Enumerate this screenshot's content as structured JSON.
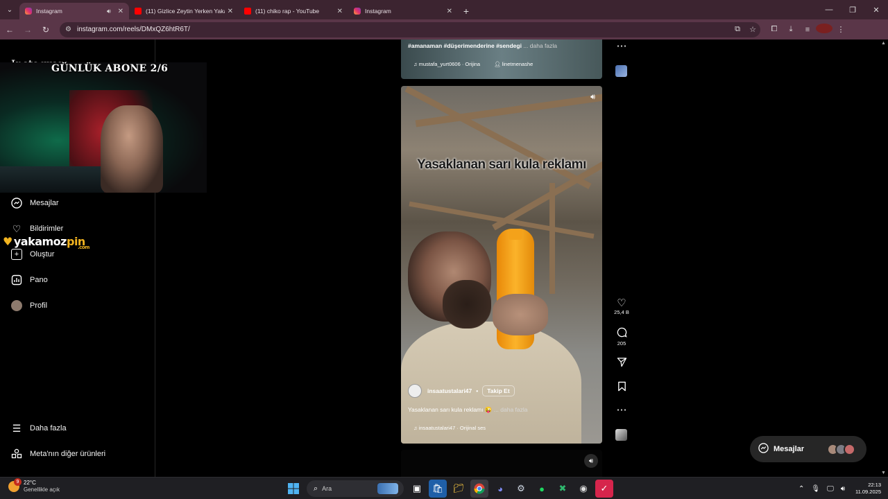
{
  "browser": {
    "tabs": [
      {
        "label": "Instagram",
        "icon": "instagram-icon",
        "active": true,
        "audio": true
      },
      {
        "label": "(11) Gizlice Zeytin Yerken Yakal...",
        "icon": "youtube-icon",
        "active": false
      },
      {
        "label": "(11) chiko rap - YouTube",
        "icon": "youtube-icon",
        "active": false
      },
      {
        "label": "Instagram",
        "icon": "instagram-icon",
        "active": false
      }
    ],
    "url": "instagram.com/reels/DMxQZ6htR6T/"
  },
  "sidebar": {
    "logo": "Instagram",
    "items": [
      {
        "label": "Mesajlar",
        "icon": "messenger-icon"
      },
      {
        "label": "Bildirimler",
        "icon": "heart-icon"
      },
      {
        "label": "Oluştur",
        "icon": "plus-square-icon"
      },
      {
        "label": "Pano",
        "icon": "dashboard-icon"
      },
      {
        "label": "Profil",
        "icon": "avatar-icon"
      }
    ],
    "bottom": [
      {
        "label": "Daha fazla",
        "icon": "hamburger-icon"
      },
      {
        "label": "Meta'nın diğer ürünleri",
        "icon": "grid-icon"
      }
    ]
  },
  "overlay": {
    "webcam_title": "GÜNLÜK ABONE 2/6",
    "watermark": {
      "main": "yakamoz",
      "accent": "pin",
      "suffix": ".com"
    }
  },
  "prev_reel": {
    "caption": "#amanaman #düşerimenderine #sendegi",
    "more": "... daha fazla",
    "audio": "mustafa_yurt0606 · Orijina",
    "tagged": "linetmenashe"
  },
  "reel": {
    "headline": "Yasaklanan sarı kula reklamı",
    "author": "insaatustalari47",
    "follow": "Takip Et",
    "caption": "Yasaklanan sarı kula reklamı 😜",
    "more": "... daha fazla",
    "audio": "insaatustalari47 · Orijinal ses"
  },
  "actions": {
    "likes": "25,4 B",
    "comments": "205"
  },
  "messages_pill": {
    "label": "Mesajlar"
  },
  "taskbar": {
    "temperature": "22°C",
    "condition": "Genellikle açık",
    "notification_count": "9",
    "search_placeholder": "Ara",
    "time": "22:13",
    "date": "11.09.2025"
  },
  "colors": {
    "tabstrip": "#3c2430",
    "toolbar": "#5a3648",
    "bottle": "#f59a1a",
    "accent_gold": "#f2b420"
  }
}
